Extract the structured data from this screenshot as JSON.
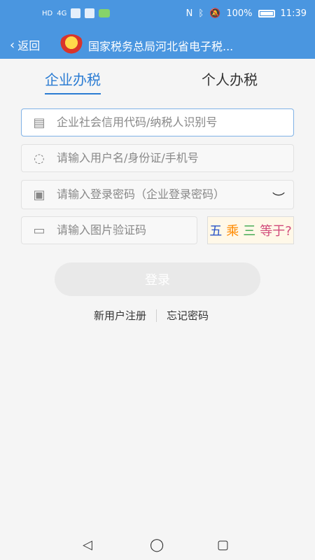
{
  "status_bar": {
    "left_text": "HD",
    "signal": "4G",
    "battery": "100%",
    "time": "11:39"
  },
  "header": {
    "back_label": "返回",
    "title": "国家税务总局河北省电子税..."
  },
  "tabs": [
    {
      "label": "企业办税",
      "active": true
    },
    {
      "label": "个人办税",
      "active": false
    }
  ],
  "form": {
    "credit_code_placeholder": "企业社会信用代码/纳税人识别号",
    "username_placeholder": "请输入用户名/身份证/手机号",
    "password_placeholder": "请输入登录密码（企业登录密码）",
    "captcha_placeholder": "请输入图片验证码",
    "captcha_text": [
      "五",
      "乘",
      "三",
      "等于?"
    ]
  },
  "actions": {
    "login_label": "登录",
    "register_label": "新用户注册",
    "forgot_label": "忘记密码"
  },
  "icons": {
    "document_icon": "doc",
    "user_icon": "user",
    "lock_icon": "lock",
    "image_icon": "image",
    "eye_icon": "eye"
  }
}
